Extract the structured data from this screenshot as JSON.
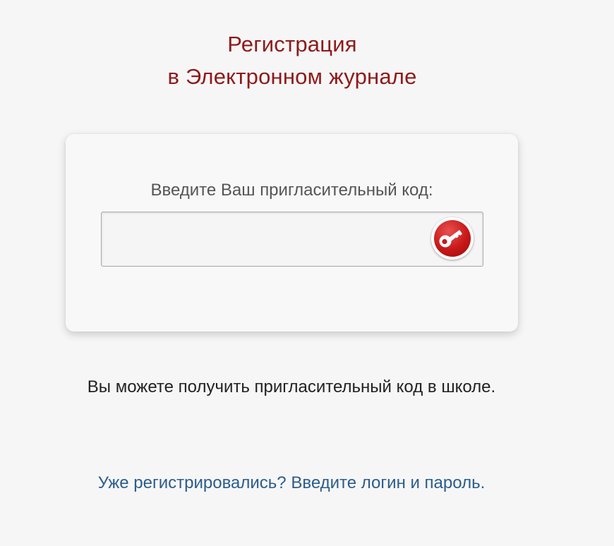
{
  "header": {
    "title_line1": "Регистрация",
    "title_line2": "в Электронном журнале"
  },
  "registration_form": {
    "label": "Введите Ваш пригласительный код:",
    "code_value": "",
    "submit_icon": "key-icon"
  },
  "info_text": "Вы можете получить пригласительный код в школе.",
  "login_link": "Уже регистрировались? Введите логин и пароль.",
  "colors": {
    "title": "#8e1a1a",
    "link": "#2b5d8c",
    "button_red": "#c81818",
    "background": "#f7f6f6"
  }
}
